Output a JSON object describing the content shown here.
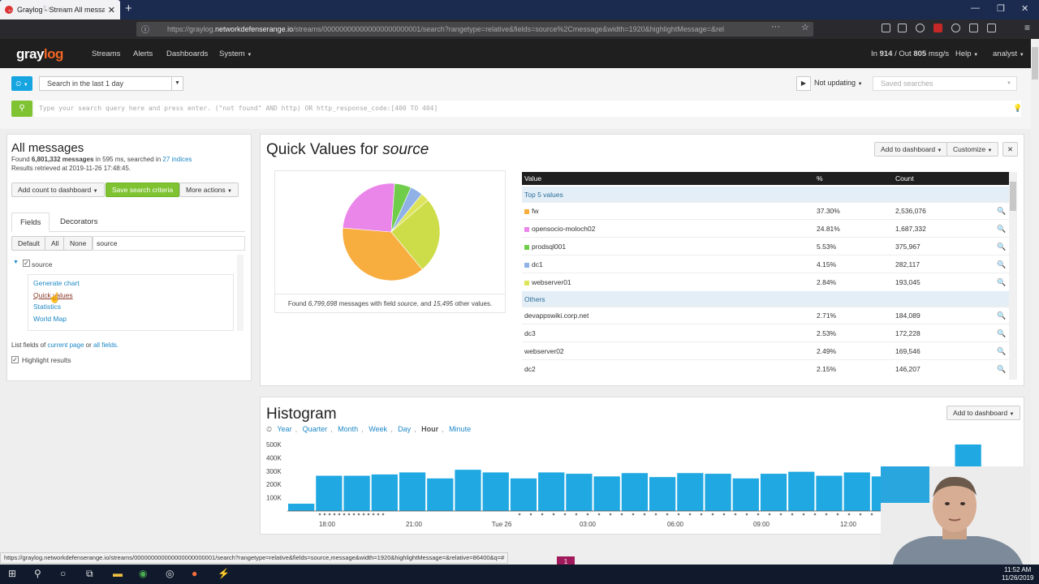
{
  "browser": {
    "tab_title": "Graylog - Stream All messages",
    "url_prefix": "https://graylog.",
    "url_domain": "networkdefenserange.io",
    "url_suffix": "/streams/000000000000000000000001/search?rangetype=relative&fields=source%2Cmessage&width=1920&highlightMessage=&rel",
    "status_url": "https://graylog.networkdefenserange.io/streams/000000000000000000000001/search?rangetype=relative&fields=source,message&width=1920&highlightMessage=&relative=86400&q=#"
  },
  "header": {
    "logo_a": "gray",
    "logo_b": "log",
    "nav": [
      "Streams",
      "Alerts",
      "Dashboards",
      "System"
    ],
    "throughput_in_label": "In",
    "throughput_in": "914",
    "throughput_out_label": "/ Out",
    "throughput_out": "805",
    "throughput_unit": "msg/s",
    "help": "Help",
    "user": "analyst"
  },
  "search": {
    "range": "Search in the last 1 day",
    "not_updating": "Not updating",
    "saved_placeholder": "Saved searches",
    "query_placeholder": "Type your search query here and press enter. (\"not found\" AND http) OR http_response_code:[400 TO 404]"
  },
  "left": {
    "title": "All messages",
    "found_prefix": "Found",
    "found_count": "6,801,332 messages",
    "found_mid": "in 595 ms, searched in",
    "indices": "27 indices",
    "retrieved": "Results retrieved at 2019-11-26 17:48:45.",
    "add_count": "Add count to dashboard",
    "save_criteria": "Save search criteria",
    "more_actions": "More actions",
    "tab_fields": "Fields",
    "tab_decorators": "Decorators",
    "filter_default": "Default",
    "filter_all": "All",
    "filter_none": "None",
    "filter_value": "source",
    "field_name": "source",
    "field_actions": [
      "Generate chart",
      "Quick values",
      "Statistics",
      "World Map"
    ],
    "list_prefix": "List fields of",
    "list_current": "current page",
    "list_or": "or",
    "list_all": "all fields.",
    "highlight": "Highlight results"
  },
  "quick_values": {
    "title_prefix": "Quick Values for",
    "title_field": "source",
    "add_dashboard": "Add to dashboard",
    "customize": "Customize",
    "found_prefix": "Found",
    "found_count": "6,799,698",
    "found_mid": "messages with field",
    "found_field": "source",
    "found_and": ", and",
    "found_other": "15,495",
    "found_suffix": "other values.",
    "col_value": "Value",
    "col_pct": "%",
    "col_count": "Count",
    "top_label": "Top 5 values",
    "others_label": "Others",
    "top": [
      {
        "value": "fw",
        "pct": "37.30%",
        "count": "2,536,076",
        "color": "#f8ad3f"
      },
      {
        "value": "opensocio-moloch02",
        "pct": "24.81%",
        "count": "1,687,332",
        "color": "#ea86ea"
      },
      {
        "value": "prodsql001",
        "pct": "5.53%",
        "count": "375,967",
        "color": "#6fcd4a"
      },
      {
        "value": "dc1",
        "pct": "4.15%",
        "count": "282,117",
        "color": "#8fb1e6"
      },
      {
        "value": "webserver01",
        "pct": "2.84%",
        "count": "193,045",
        "color": "#dde45a"
      }
    ],
    "others": [
      {
        "value": "devappswiki.corp.net",
        "pct": "2.71%",
        "count": "184,089"
      },
      {
        "value": "dc3",
        "pct": "2.53%",
        "count": "172,228"
      },
      {
        "value": "webserver02",
        "pct": "2.49%",
        "count": "169,546"
      },
      {
        "value": "dc2",
        "pct": "2.15%",
        "count": "146,207"
      }
    ],
    "pie_other_color": "#cddd4a"
  },
  "histogram": {
    "title": "Histogram",
    "add_dashboard": "Add to dashboard",
    "resolutions": [
      "Year",
      "Quarter",
      "Month",
      "Week",
      "Day",
      "Hour",
      "Minute"
    ],
    "active_resolution": "Hour",
    "bar_color": "#1fa8e1"
  },
  "chart_data": {
    "type": "bar",
    "ylabels": [
      "500K",
      "400K",
      "300K",
      "200K",
      "100K"
    ],
    "xlabels": [
      "18:00",
      "21:00",
      "Tue 26",
      "03:00",
      "06:00",
      "09:00",
      "12:00",
      "18:0"
    ],
    "ylim": [
      0,
      500000
    ],
    "values": [
      55000,
      265000,
      265000,
      275000,
      290000,
      245000,
      310000,
      290000,
      245000,
      290000,
      280000,
      260000,
      285000,
      255000,
      285000,
      280000,
      245000,
      280000,
      295000,
      265000,
      290000,
      260000,
      265000,
      300000,
      500000,
      220000
    ]
  },
  "taskbar": {
    "time": "11:52 AM",
    "date": "11/26/2019"
  }
}
